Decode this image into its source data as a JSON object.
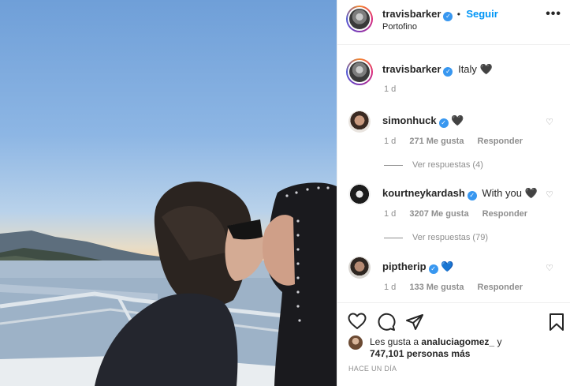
{
  "post": {
    "header": {
      "username": "travisbarker",
      "verified": true,
      "separator": "•",
      "follow_label": "Seguir",
      "location": "Portofino",
      "more_icon": "more-horizontal-icon"
    },
    "caption": {
      "username": "travisbarker",
      "text": "Italy",
      "emoji": "🖤",
      "time": "1 d"
    },
    "comments": [
      {
        "username": "simonhuck",
        "text": "",
        "emoji": "🖤",
        "time": "1 d",
        "likes": "271 Me gusta",
        "reply_label": "Responder",
        "replies_label": "Ver respuestas (4)"
      },
      {
        "username": "kourtneykardash",
        "text": "With you",
        "emoji": "🖤",
        "time": "1 d",
        "likes": "3207 Me gusta",
        "reply_label": "Responder",
        "replies_label": "Ver respuestas (79)"
      },
      {
        "username": "piptherip",
        "text": "",
        "emoji": "💙",
        "time": "1 d",
        "likes": "133 Me gusta",
        "reply_label": "Responder"
      }
    ],
    "actions": {
      "like_icon": "heart-outline-icon",
      "comment_icon": "comment-icon",
      "share_icon": "paper-plane-icon",
      "save_icon": "bookmark-icon"
    },
    "likes": {
      "prefix": "Les gusta a",
      "user": "analuciagomez_",
      "conj": "y",
      "count": "747,101 personas más"
    },
    "timestamp": "HACE UN DÍA",
    "colors": {
      "accent": "#0095f6",
      "verified": "#3897f0",
      "text": "#262626",
      "muted": "#8e8e8e",
      "blue_heart": "#3897f0"
    }
  }
}
